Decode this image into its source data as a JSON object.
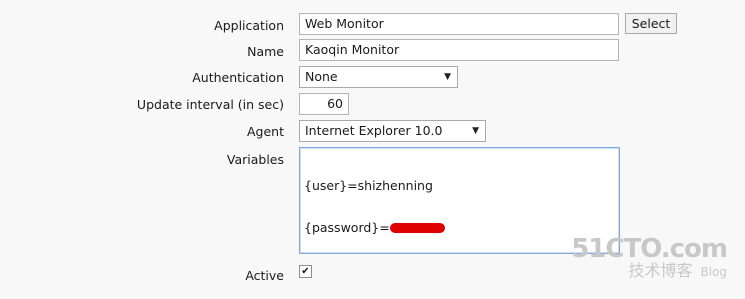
{
  "form": {
    "application": {
      "label": "Application",
      "value": "Web Monitor",
      "button": "Select"
    },
    "name": {
      "label": "Name",
      "value": "Kaoqin Monitor"
    },
    "authentication": {
      "label": "Authentication",
      "selected": "None"
    },
    "update_interval": {
      "label": "Update interval (in sec)",
      "value": "60"
    },
    "agent": {
      "label": "Agent",
      "selected": "Internet Explorer 10.0"
    },
    "variables": {
      "label": "Variables",
      "line1": "{user}=shizhenning",
      "line2_prefix": "{password}="
    },
    "active": {
      "label": "Active",
      "checked": true
    }
  },
  "watermark": {
    "logo": "51CTO.com",
    "sub": "技术博客",
    "blog": "Blog"
  },
  "colors": {
    "textarea_border": "#7ea9d5",
    "redaction": "#e00000"
  }
}
